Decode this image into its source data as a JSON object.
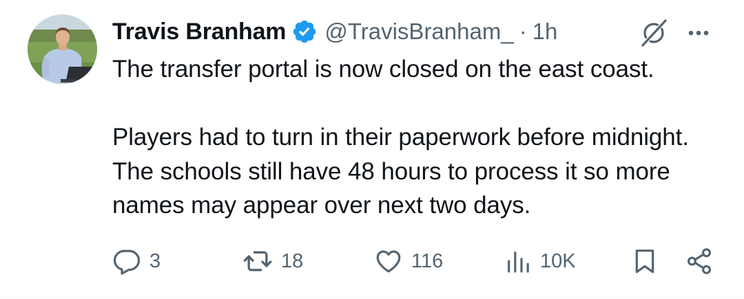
{
  "author": {
    "display_name": "Travis Branham",
    "handle": "@TravisBranham_",
    "separator": "·",
    "time": "1h",
    "verified": true
  },
  "tweet": {
    "text": "The transfer portal is now closed on the east coast.\n\nPlayers had to turn in their paperwork before midnight. The schools still have 48 hours to process it so more names may appear over next two days."
  },
  "actions": {
    "replies": "3",
    "reposts": "18",
    "likes": "116",
    "views": "10K"
  },
  "colors": {
    "text": "#0f1419",
    "secondary": "#536471",
    "verified_badge": "#1d9bf0"
  },
  "icons": {
    "verified": "verified-badge-icon",
    "grok": "grok-icon",
    "more": "more-icon",
    "reply": "reply-icon",
    "repost": "repost-icon",
    "like": "heart-icon",
    "views": "views-icon",
    "bookmark": "bookmark-icon",
    "share": "share-icon"
  }
}
